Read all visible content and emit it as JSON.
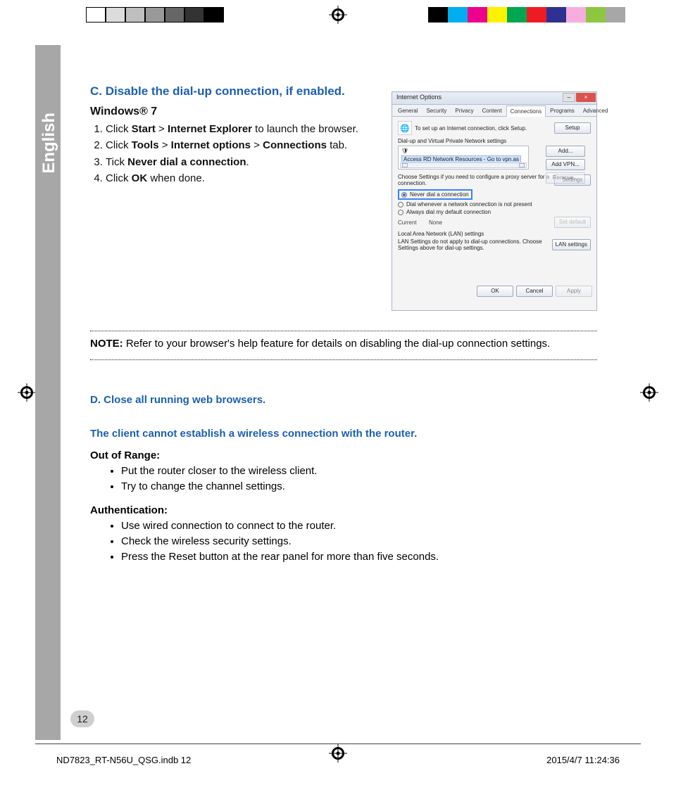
{
  "language_label": "English",
  "page_number": "12",
  "footer": {
    "left": "ND7823_RT-N56U_QSG.indb   12",
    "right": "2015/4/7   11:24:36"
  },
  "color_bar_left": [
    "#ffffff",
    "#dcdcdc",
    "#bfbfbf",
    "#999999",
    "#666666",
    "#333333",
    "#000000"
  ],
  "color_bar_right": [
    "#000000",
    "#00aeef",
    "#ec008c",
    "#fff200",
    "#00a651",
    "#ed1c24",
    "#2e3192",
    "#f7adde",
    "#8dc63f",
    "#a7a7a7"
  ],
  "section_c": {
    "title": "C.   Disable the dial-up connection, if enabled.",
    "windows_label": "Windows® 7",
    "steps": [
      [
        "Click ",
        "Start",
        " > ",
        "Internet Explorer",
        " to launch the browser."
      ],
      [
        "Click ",
        "Tools",
        " > ",
        "Internet options",
        " > ",
        "Connections",
        " tab."
      ],
      [
        "Tick ",
        "Never dial a connection",
        "."
      ],
      [
        "Click ",
        "OK",
        " when done."
      ]
    ]
  },
  "note": {
    "label": "NOTE:",
    "text": "  Refer to your browser's help feature for details on disabling the dial-up connection settings."
  },
  "section_d": {
    "title": "D.   Close all running web browsers."
  },
  "problem": {
    "title": "The client cannot establish a wireless connection with the router.",
    "out_of_range": {
      "label": "Out of Range:",
      "items": [
        "Put the router closer to the wireless client.",
        "Try to change the channel settings."
      ]
    },
    "authentication": {
      "label": "Authentication:",
      "items": [
        "Use wired connection to connect to the router.",
        "Check the wireless security settings.",
        "Press the Reset button at the rear panel for more than five seconds."
      ]
    }
  },
  "dialog": {
    "title": "Internet Options",
    "close": "×",
    "tabs": [
      "General",
      "Security",
      "Privacy",
      "Content",
      "Connections",
      "Programs",
      "Advanced"
    ],
    "active_tab_index": 4,
    "setup_text": "To set up an Internet connection, click Setup.",
    "setup_btn": "Setup",
    "group_dial": "Dial-up and Virtual Private Network settings",
    "dial_entry": "Access RD Network Resources - Go to vpn.as",
    "btn_add": "Add...",
    "btn_addvpn": "Add VPN...",
    "btn_remove": "Remove...",
    "settings_text": "Choose Settings if you need to configure a proxy server for a connection.",
    "btn_settings": "Settings",
    "radio_never": "Never dial a connection",
    "radio_not_present": "Dial whenever a network connection is not present",
    "radio_always": "Always dial my default connection",
    "current_label": "Current",
    "current_value": "None",
    "btn_setdefault": "Set default",
    "group_lan": "Local Area Network (LAN) settings",
    "lan_text": "LAN Settings do not apply to dial-up connections. Choose Settings above for dial-up settings.",
    "btn_lan": "LAN settings",
    "btn_ok": "OK",
    "btn_cancel": "Cancel",
    "btn_apply": "Apply"
  }
}
